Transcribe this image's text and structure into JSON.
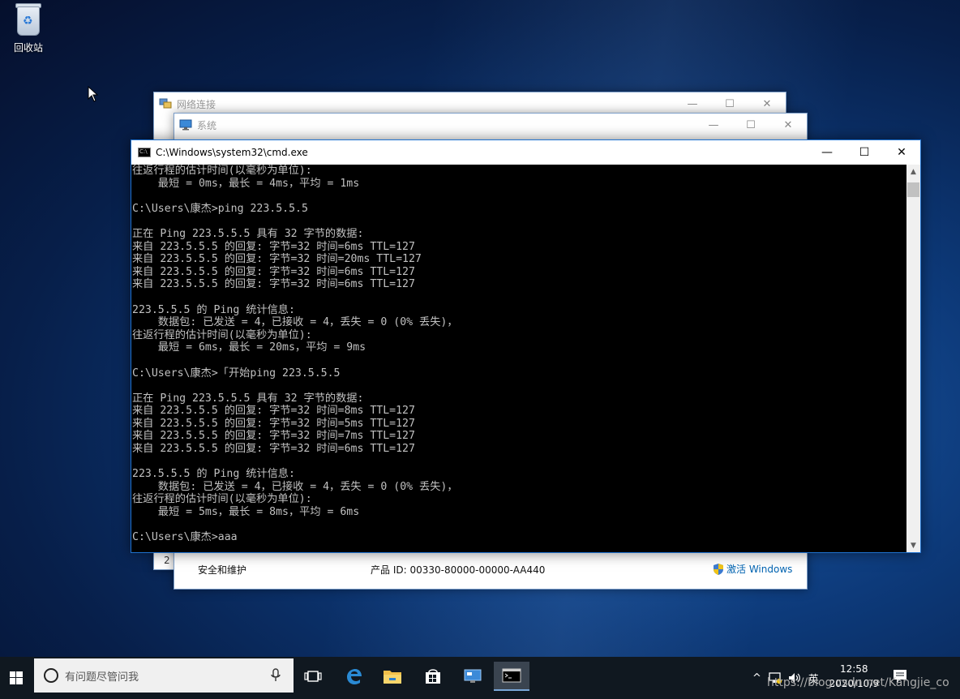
{
  "desktop": {
    "recycle_bin_label": "回收站"
  },
  "network_window": {
    "title": "网络连接",
    "partial_text": "2"
  },
  "system_window": {
    "title": "系统",
    "security_link": "安全和维护",
    "product_id": "产品 ID: 00330-80000-00000-AA440",
    "activate": "激活 Windows"
  },
  "cmd_window": {
    "title": "C:\\Windows\\system32\\cmd.exe",
    "lines": [
      "往返行程的估计时间(以毫秒为单位):",
      "    最短 = 0ms，最长 = 4ms，平均 = 1ms",
      "",
      "C:\\Users\\康杰>ping 223.5.5.5",
      "",
      "正在 Ping 223.5.5.5 具有 32 字节的数据:",
      "来自 223.5.5.5 的回复: 字节=32 时间=6ms TTL=127",
      "来自 223.5.5.5 的回复: 字节=32 时间=20ms TTL=127",
      "来自 223.5.5.5 的回复: 字节=32 时间=6ms TTL=127",
      "来自 223.5.5.5 的回复: 字节=32 时间=6ms TTL=127",
      "",
      "223.5.5.5 的 Ping 统计信息:",
      "    数据包: 已发送 = 4，已接收 = 4，丢失 = 0 (0% 丢失)，",
      "往返行程的估计时间(以毫秒为单位):",
      "    最短 = 6ms，最长 = 20ms，平均 = 9ms",
      "",
      "C:\\Users\\康杰>「开始ping 223.5.5.5",
      "",
      "正在 Ping 223.5.5.5 具有 32 字节的数据:",
      "来自 223.5.5.5 的回复: 字节=32 时间=8ms TTL=127",
      "来自 223.5.5.5 的回复: 字节=32 时间=5ms TTL=127",
      "来自 223.5.5.5 的回复: 字节=32 时间=7ms TTL=127",
      "来自 223.5.5.5 的回复: 字节=32 时间=6ms TTL=127",
      "",
      "223.5.5.5 的 Ping 统计信息:",
      "    数据包: 已发送 = 4，已接收 = 4，丢失 = 0 (0% 丢失)，",
      "往返行程的估计时间(以毫秒为单位):",
      "    最短 = 5ms，最长 = 8ms，平均 = 6ms",
      "",
      "C:\\Users\\康杰>aaa"
    ]
  },
  "taskbar": {
    "search_placeholder": "有问题尽管问我",
    "time": "12:58",
    "date": "2020/10/9",
    "ime": "英",
    "icons": [
      "start-icon",
      "task-view-icon",
      "edge-icon",
      "file-explorer-icon",
      "store-icon",
      "network-connections-icon",
      "cmd-icon"
    ]
  },
  "watermark": "https://blog.csdn.net/Kangjie_co"
}
